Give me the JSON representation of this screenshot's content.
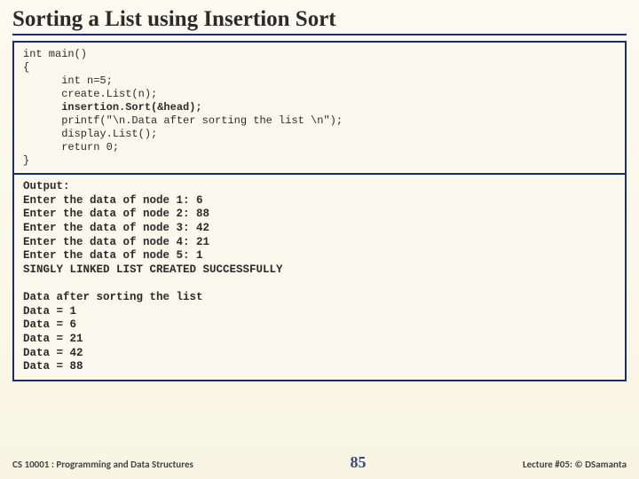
{
  "title": "Sorting a List using Insertion Sort",
  "code": {
    "line1": "int main()",
    "line2": "{",
    "line3": "      int n=5;",
    "line4": "      create.List(n);",
    "line5": "      insertion.Sort(&head);",
    "line6": "      printf(\"\\n.Data after sorting the list \\n\");",
    "line7": "      display.List();",
    "line8": "      return 0;",
    "line9": "}"
  },
  "output": {
    "header": "Output:",
    "l1": "Enter the data of node 1: 6",
    "l2": "Enter the data of node 2: 88",
    "l3": "Enter the data of node 3: 42",
    "l4": "Enter the data of node 4: 21",
    "l5": "Enter the data of node 5: 1",
    "l6": "SINGLY LINKED LIST CREATED SUCCESSFULLY",
    "l7": "",
    "l8": "Data after sorting the list",
    "l9": "Data = 1",
    "l10": "Data = 6",
    "l11": "Data = 21",
    "l12": "Data = 42",
    "l13": "Data = 88"
  },
  "footer": {
    "left": "CS 10001 : Programming and Data Structures",
    "page": "85",
    "right": "Lecture #05: © DSamanta"
  }
}
